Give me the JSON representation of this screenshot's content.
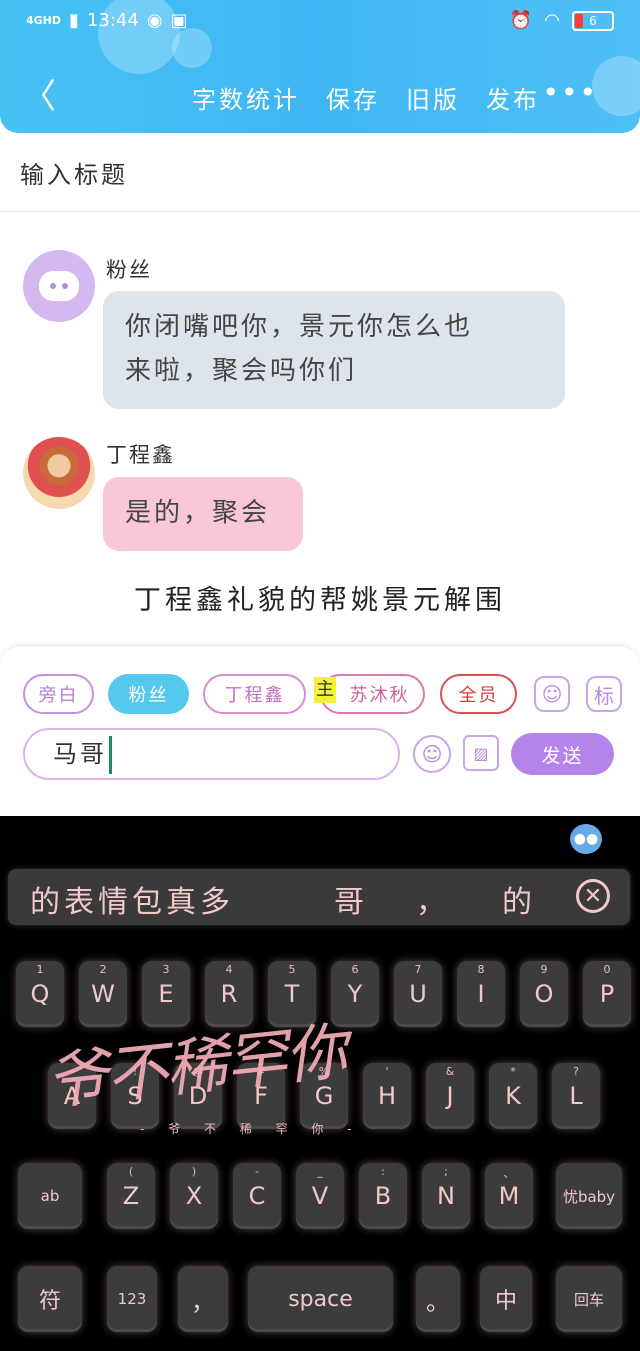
{
  "status_bar": {
    "network": "4GHD",
    "time": "13:44",
    "battery": "6"
  },
  "nav": {
    "back_icon": "chevron-left-icon",
    "items": [
      "字数统计",
      "保存",
      "旧版",
      "发布"
    ],
    "more": "•••"
  },
  "title_input": {
    "placeholder": "输入标题"
  },
  "messages": [
    {
      "name": "粉丝",
      "text_line1": "你闭嘴吧你，景元你怎么也",
      "text_line2": "来啦，聚会吗你们",
      "bubble_color": "#dde4ec"
    },
    {
      "name": "丁程鑫",
      "text": "是的，聚会",
      "bubble_color": "#f9c8d6"
    }
  ],
  "narration": "丁程鑫礼貌的帮姚景元解围",
  "roles": {
    "pangbai": "旁白",
    "fensi": "粉丝",
    "ding": "丁程鑫",
    "zhu_badge": "主",
    "su": "苏沐秋",
    "quanyuan": "全员"
  },
  "role_icon": "标",
  "composer": {
    "value": "马哥",
    "send": "发送"
  },
  "keyboard": {
    "candidates": [
      "的表情包真多",
      "哥",
      "，",
      "的"
    ],
    "row1": [
      {
        "k": "Q",
        "h": "1"
      },
      {
        "k": "W",
        "h": "2"
      },
      {
        "k": "E",
        "h": "3"
      },
      {
        "k": "R",
        "h": "4"
      },
      {
        "k": "T",
        "h": "5"
      },
      {
        "k": "Y",
        "h": "6"
      },
      {
        "k": "U",
        "h": "7"
      },
      {
        "k": "I",
        "h": "8"
      },
      {
        "k": "O",
        "h": "9"
      },
      {
        "k": "P",
        "h": "0"
      }
    ],
    "row2": [
      {
        "k": "A",
        "h": "~"
      },
      {
        "k": "S",
        "h": "!"
      },
      {
        "k": "D",
        "h": "@"
      },
      {
        "k": "F",
        "h": "#"
      },
      {
        "k": "G",
        "h": "%"
      },
      {
        "k": "H",
        "h": "'"
      },
      {
        "k": "J",
        "h": "&"
      },
      {
        "k": "K",
        "h": "*"
      },
      {
        "k": "L",
        "h": "?"
      }
    ],
    "row3": [
      {
        "k": "Z",
        "h": "("
      },
      {
        "k": "X",
        "h": ")"
      },
      {
        "k": "C",
        "h": "-"
      },
      {
        "k": "V",
        "h": "_"
      },
      {
        "k": "B",
        "h": ":"
      },
      {
        "k": "N",
        "h": ";"
      },
      {
        "k": "M",
        "h": "、"
      }
    ],
    "ab": "ab",
    "skin": "忧baby",
    "fu": "符",
    "num": "123",
    "comma": "，",
    "space": "space",
    "period": "。",
    "zhong": "中",
    "enter": "回车",
    "handwriting": "爷不稀罕你",
    "handwriting_sub": "- 爷 不 稀 罕 你 -"
  }
}
